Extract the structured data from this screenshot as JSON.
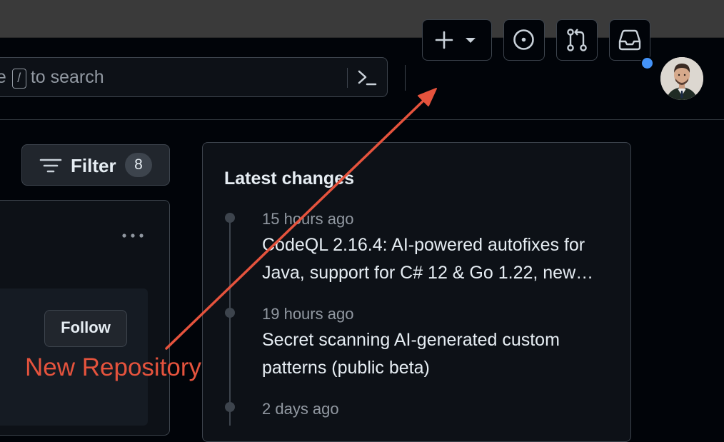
{
  "header": {
    "search": {
      "prefix": "pe",
      "key": "/",
      "suffix": "to search"
    },
    "new_button": {
      "icon": "plus-icon",
      "dropdown_icon": "triangle-down-icon"
    },
    "icons": [
      "terminal-icon",
      "issue-opened-icon",
      "git-pull-request-icon",
      "inbox-icon"
    ],
    "notification_color": "#4493f8"
  },
  "filter": {
    "label": "Filter",
    "count": "8"
  },
  "feed": {
    "follow_label": "Follow"
  },
  "changes": {
    "title": "Latest changes",
    "items": [
      {
        "time": "15 hours ago",
        "title": "CodeQL 2.16.4: AI-powered autofixes for Java, support for C# 12 & Go 1.22, new…"
      },
      {
        "time": "19 hours ago",
        "title": "Secret scanning AI-generated custom patterns (public beta)"
      },
      {
        "time": "2 days ago",
        "title": ""
      }
    ]
  },
  "annotation": {
    "text": "New Repository",
    "color": "#e5533d"
  }
}
